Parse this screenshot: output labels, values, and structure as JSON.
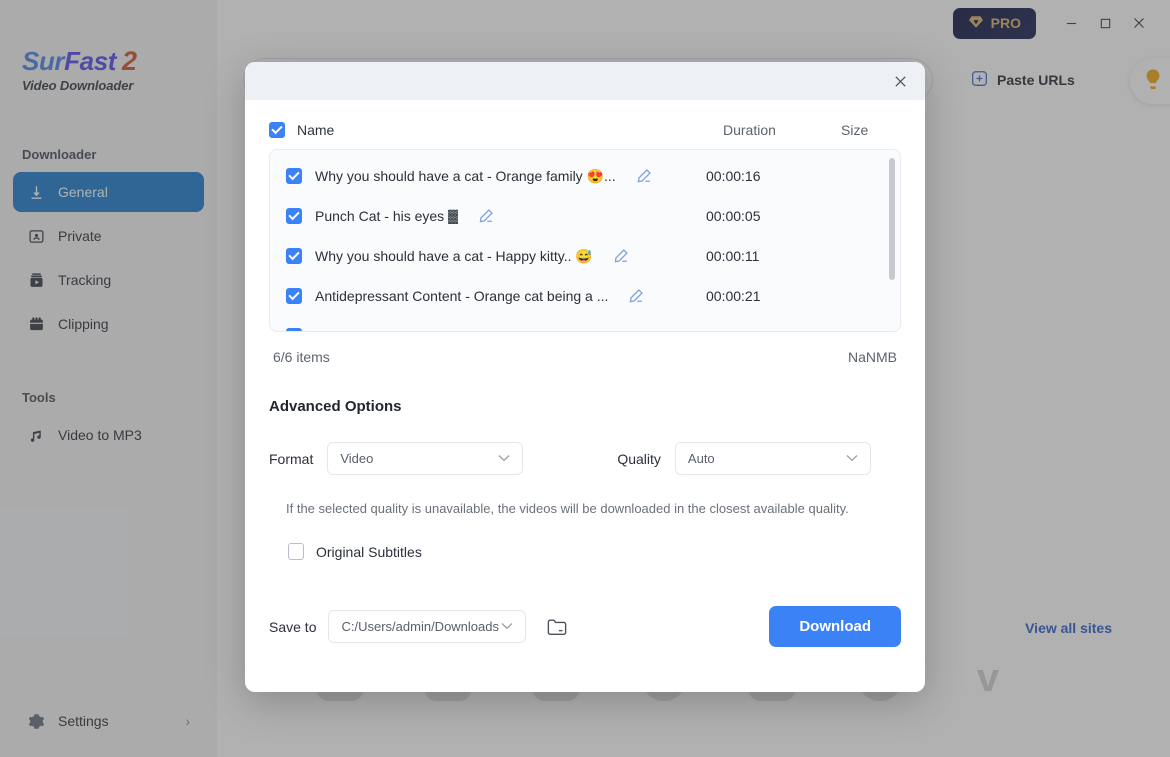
{
  "sidebar": {
    "logo": {
      "part1": "Sur",
      "part2": "Fast",
      "part3": "2",
      "subtitle": "Video Downloader"
    },
    "section_downloader": "Downloader",
    "section_tools": "Tools",
    "nav": [
      {
        "label": "General",
        "icon": "download-arrow-icon",
        "active": true
      },
      {
        "label": "Private",
        "icon": "private-user-icon",
        "active": false
      },
      {
        "label": "Tracking",
        "icon": "tracking-film-icon",
        "active": false
      },
      {
        "label": "Clipping",
        "icon": "clipping-calendar-icon",
        "active": false
      }
    ],
    "tools": [
      {
        "label": "Video to MP3",
        "icon": "music-note-icon"
      }
    ],
    "settings": {
      "label": "Settings",
      "icon": "gear-icon",
      "chevron": "›"
    }
  },
  "titlebar": {
    "pro_label": "PRO",
    "pro_icon": "diamond-icon",
    "minimize": "–",
    "maximize": "□",
    "close": "✕"
  },
  "topbar": {
    "paste_urls_label": "Paste URLs",
    "paste_urls_icon": "plus-square-icon",
    "bulb_icon": "lightbulb-icon",
    "globe_icon": "globe-icon"
  },
  "background": {
    "view_all_sites": "View all sites"
  },
  "modal": {
    "close_icon": "close-icon",
    "columns": {
      "name": "Name",
      "duration": "Duration",
      "size": "Size"
    },
    "select_all_checked": true,
    "items": [
      {
        "checked": true,
        "title": "Why you should have a cat - Orange family 😍...",
        "duration": "00:00:16",
        "size": ""
      },
      {
        "checked": true,
        "title": "Punch Cat - his eyes ▓",
        "duration": "00:00:05",
        "size": ""
      },
      {
        "checked": true,
        "title": "Why you should have a cat - Happy kitty.. 😅",
        "duration": "00:00:11",
        "size": ""
      },
      {
        "checked": true,
        "title": "Antidepressant Content - Orange cat being a ...",
        "duration": "00:00:21",
        "size": ""
      }
    ],
    "edit_icon": "pencil-edit-icon",
    "footer": {
      "items_count": "6/6 items",
      "total_size": "NaNMB"
    },
    "advanced_options_title": "Advanced Options",
    "format": {
      "label": "Format",
      "value": "Video",
      "placeholder": "Video"
    },
    "quality": {
      "label": "Quality",
      "value": "Auto",
      "placeholder": "Auto"
    },
    "quality_hint": "If the selected quality is unavailable, the videos will be downloaded in the closest available quality.",
    "original_subtitles": {
      "label": "Original Subtitles",
      "checked": false
    },
    "save_to": {
      "label": "Save to",
      "value": "C:/Users/admin/Downloads",
      "folder_icon": "folder-open-icon"
    },
    "download_button": "Download"
  },
  "colors": {
    "accent_blue": "#3b82f6",
    "sidebar_active": "#1f7fd0",
    "pro_gold": "#d9b36a",
    "pro_bg": "#141a45",
    "link_blue": "#2f63c8"
  }
}
